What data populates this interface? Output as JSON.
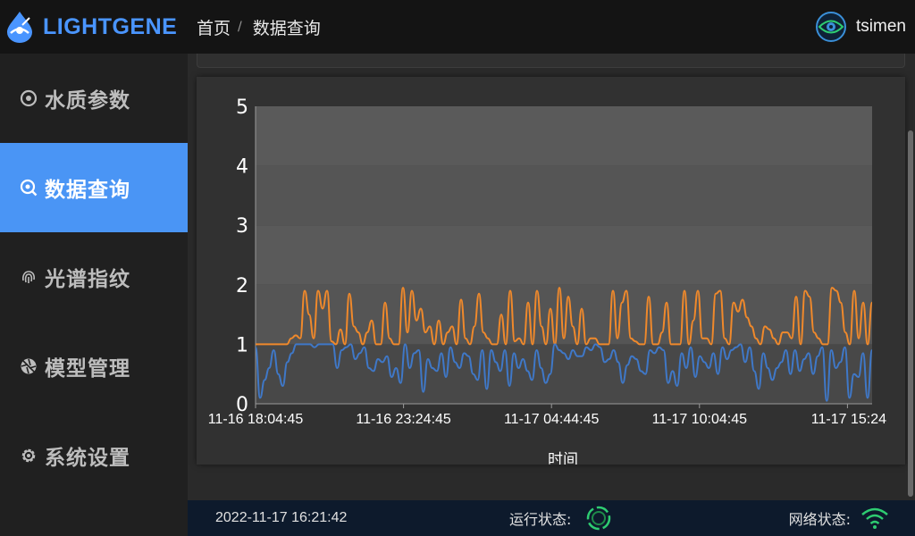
{
  "brand": {
    "name": "LIGHTGENE"
  },
  "sidebar": {
    "items": [
      {
        "label": "水质参数",
        "icon": "gauge-icon",
        "active": false
      },
      {
        "label": "数据查询",
        "icon": "search-icon",
        "active": true
      },
      {
        "label": "光谱指纹",
        "icon": "fingerprint-icon",
        "active": false
      },
      {
        "label": "模型管理",
        "icon": "aperture-icon",
        "active": false
      },
      {
        "label": "系统设置",
        "icon": "gear-icon",
        "active": false
      }
    ]
  },
  "header": {
    "breadcrumb_home": "首页",
    "breadcrumb_separator": "/",
    "breadcrumb_current": "数据查询",
    "user_name": "tsimen"
  },
  "footer": {
    "datetime": "2022-11-17 16:21:42",
    "run_status_label": "运行状态:",
    "network_status_label": "网络状态:"
  },
  "colors": {
    "accent": "#4a95f5",
    "series_orange": "#f0892b",
    "series_blue": "#3f78c8",
    "run_ok": "#2ecc71"
  },
  "chart_data": {
    "type": "line",
    "xlabel": "时间",
    "ylabel": "",
    "ylim": [
      0,
      5
    ],
    "yticks": [
      0,
      1,
      2,
      3,
      4,
      5
    ],
    "x_tick_labels": [
      "11-16 18:04:45",
      "11-16 23:24:45",
      "11-17 04:44:45",
      "11-17 10:04:45",
      "11-17 15:24"
    ],
    "x_tick_fracs": [
      0.0,
      0.24,
      0.48,
      0.72,
      0.96
    ],
    "split_value": 1,
    "series": [
      {
        "color": "#f0892b",
        "values": [
          1,
          1,
          1,
          1,
          1,
          1,
          1,
          1,
          1.1,
          1.15,
          1.1,
          1.9,
          1.5,
          1.1,
          1.9,
          1.6,
          1.9,
          1.05,
          1,
          1.25,
          1,
          1.85,
          1.3,
          1.2,
          1,
          1.2,
          1.4,
          1,
          1,
          1.7,
          1.1,
          1,
          1,
          1.95,
          1.2,
          1.9,
          1.4,
          1.6,
          1.2,
          1.3,
          1,
          1.4,
          1,
          1.2,
          1.3,
          1,
          1.75,
          1.1,
          1,
          1.3,
          1.85,
          1.2,
          1.1,
          1,
          1,
          1.5,
          1,
          1.9,
          1.05,
          1.1,
          1,
          1.7,
          1,
          1.9,
          1.3,
          1,
          1.6,
          1,
          1.95,
          1.1,
          1.8,
          1.3,
          1,
          1.6,
          1,
          1.1,
          1.1,
          1,
          1,
          1,
          1.9,
          1.1,
          1.7,
          1.9,
          1.1,
          1.05,
          1,
          1,
          1.8,
          1,
          1,
          1.2,
          1.7,
          1,
          1,
          1,
          1.9,
          1,
          1.4,
          1.9,
          1.1,
          1.1,
          1,
          1.85,
          1.9,
          1.1,
          1,
          1.7,
          1.55,
          1.75,
          1.45,
          1.3,
          1.1,
          1,
          1.3,
          1.25,
          1.1,
          1,
          1.2,
          1.2,
          1.1,
          1.8,
          1,
          1.9,
          1.8,
          1.2,
          1.1,
          1,
          1,
          1.95,
          1.9,
          1.7,
          1.2,
          1,
          1.9,
          1.1,
          1.7,
          1,
          1.7
        ]
      },
      {
        "color": "#3f78c8",
        "values": [
          0.95,
          0.1,
          0.4,
          0.6,
          0.9,
          0.5,
          0.3,
          0.7,
          0.85,
          1,
          1,
          1,
          1,
          0.95,
          1,
          1,
          1,
          1,
          0.6,
          0.9,
          0.95,
          1,
          0.75,
          0.85,
          0.95,
          0.6,
          0.55,
          0.75,
          0.7,
          0.8,
          0.45,
          0.6,
          0.35,
          1,
          0.6,
          0.85,
          0.9,
          0.2,
          0.75,
          0.6,
          0.55,
          0.85,
          0.45,
          0.95,
          0.7,
          0.6,
          0.85,
          0.8,
          0.5,
          0.4,
          0.9,
          0.25,
          0.9,
          0.7,
          0.55,
          0.9,
          0.3,
          0.85,
          0.6,
          0.75,
          0.55,
          0.4,
          0.9,
          0.6,
          0.35,
          0.5,
          1,
          0.9,
          0.85,
          0.75,
          0.9,
          0.8,
          0.8,
          0.95,
          0.9,
          1,
          0.95,
          0.7,
          0.75,
          0.9,
          0.7,
          0.35,
          0.65,
          0.8,
          0.75,
          0.55,
          0.5,
          0.9,
          0.85,
          0.95,
          0.9,
          0.35,
          0.55,
          0.3,
          0.85,
          0.6,
          0.95,
          0.45,
          0.8,
          0.7,
          0.6,
          0.85,
          0.5,
          0.95,
          0.75,
          0.9,
          0.95,
          1,
          0.7,
          0.95,
          0.55,
          0.25,
          0.85,
          0.6,
          0.4,
          0.6,
          0.7,
          0.9,
          0.5,
          0.9,
          0.55,
          0.75,
          0.85,
          0.5,
          0.8,
          0.95,
          0.05,
          0.9,
          0.6,
          0.7,
          0.95,
          0.1,
          0.5,
          0.45,
          0.85,
          0.1,
          0.9
        ]
      }
    ]
  }
}
